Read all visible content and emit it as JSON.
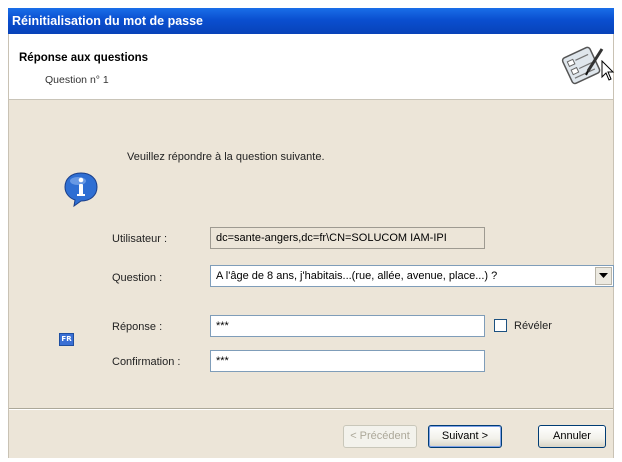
{
  "window": {
    "title": "Réinitialisation du mot de passe"
  },
  "header": {
    "title": "Réponse aux questions",
    "subtitle": "Question n° 1",
    "icon": "form-pen-icon"
  },
  "instruction": "Veuillez répondre à la question suivante.",
  "form": {
    "user_label": "Utilisateur :",
    "user_value": "dc=sante-angers,dc=fr\\CN=SOLUCOM IAM-IPI",
    "question_label": "Question :",
    "question_value": "A l'âge de 8 ans, j'habitais...(rue, allée, avenue, place...) ?",
    "answer_label": "Réponse :",
    "answer_value": "***",
    "reveal_label": "Révéler",
    "reveal_checked": false,
    "confirm_label": "Confirmation :",
    "confirm_value": "***",
    "language_badge": "FR"
  },
  "buttons": {
    "previous": "< Précédent",
    "next": "Suivant >",
    "cancel": "Annuler"
  },
  "colors": {
    "titlebar": "#0a4fd0",
    "dialog_bg": "#ece5d8",
    "info_icon": "#2f6fd3"
  }
}
